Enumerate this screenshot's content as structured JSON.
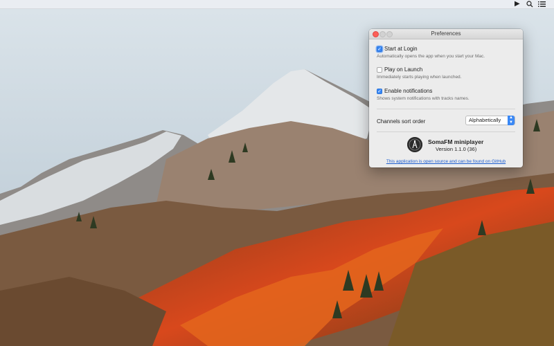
{
  "menubar": {
    "icons": [
      "play-icon",
      "search-icon",
      "list-icon"
    ]
  },
  "window": {
    "title": "Preferences",
    "options": [
      {
        "label": "Start at Login",
        "description": "Automatically opens the app when you start your Mac.",
        "checked": true
      },
      {
        "label": "Play on Launch",
        "description": "Immediately starts playing when launched.",
        "checked": false
      },
      {
        "label": "Enable notifications",
        "description": "Shows system notifications with tracks names.",
        "checked": true
      }
    ],
    "sort": {
      "label": "Channels sort order",
      "selected": "Alphabetically"
    },
    "about": {
      "name": "SomaFM miniplayer",
      "version": "Version 1.1.0 (36)",
      "link_text": "This application is open source and can be found on GitHub"
    }
  },
  "colors": {
    "accent": "#3a88f5",
    "close": "#fc5f57",
    "link": "#1a5ccf"
  }
}
